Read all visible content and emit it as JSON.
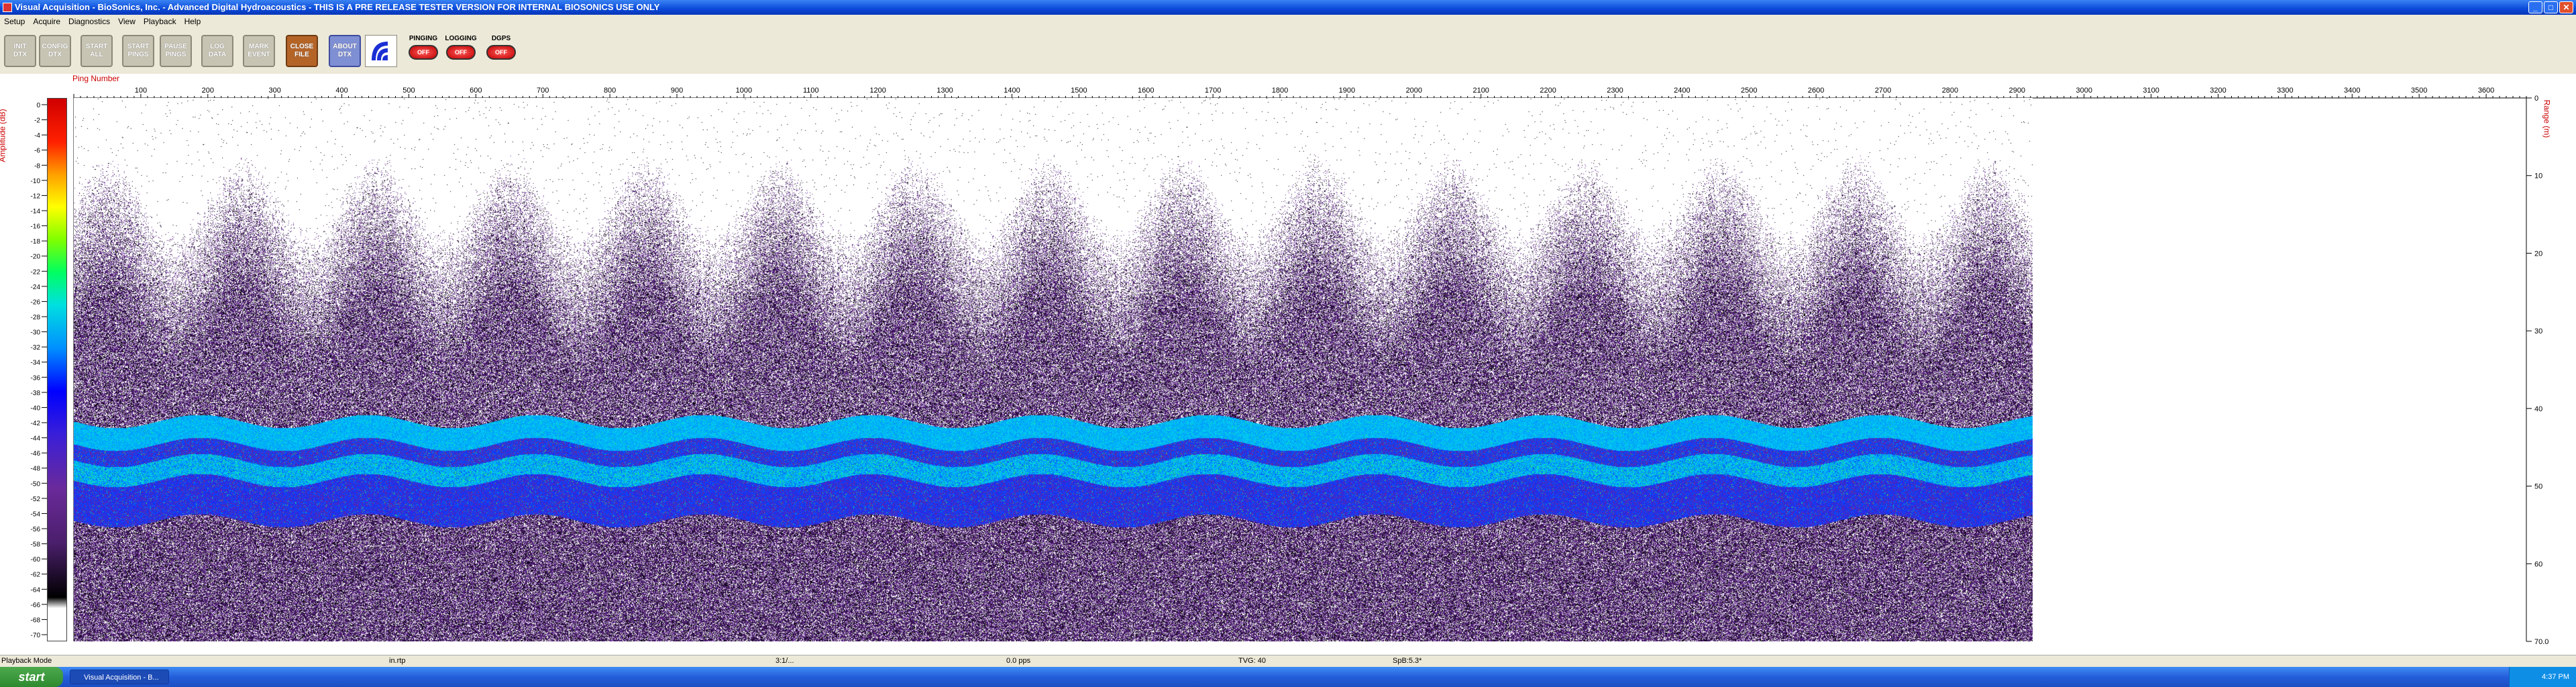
{
  "window": {
    "title": "Visual Acquisition  -  BioSonics, Inc.  -  Advanced Digital Hydroacoustics  -  THIS IS A PRE RELEASE TESTER VERSION FOR INTERNAL BIOSONICS USE ONLY"
  },
  "menu": [
    "Setup",
    "Acquire",
    "Diagnostics",
    "View",
    "Playback",
    "Help"
  ],
  "toolbar": {
    "buttons": [
      {
        "label": "INIT\nDTX",
        "color": "#c7c4b3"
      },
      {
        "label": "CONFIG\nDTX",
        "color": "#c7c4b3"
      },
      {
        "label": "START\nALL",
        "color": "#c7c4b3"
      },
      {
        "label": "START\nPINGS",
        "color": "#c7c4b3"
      },
      {
        "label": "PAUSE\nPINGS",
        "color": "#c7c4b3"
      },
      {
        "label": "LOG\nDATA",
        "color": "#c7c4b3"
      },
      {
        "label": "MARK\nEVENT",
        "color": "#c7c4b3"
      },
      {
        "label": "CLOSE\nFILE",
        "color": "#b56428"
      },
      {
        "label": "ABOUT\nDTX",
        "color": "#7f8fd3"
      }
    ],
    "indicators": [
      {
        "label": "PINGING",
        "state": "OFF"
      },
      {
        "label": "LOGGING",
        "state": "OFF"
      },
      {
        "label": "DGPS",
        "state": "OFF"
      }
    ]
  },
  "echogram": {
    "ping_axis_label": "Ping Number",
    "amp_axis_label": "Amplitude (dB)",
    "range_axis_label": "Range (m)",
    "ping_ticks": [
      100,
      200,
      300,
      400,
      500,
      600,
      700,
      800,
      900,
      1000,
      1100,
      1200,
      1300,
      1400,
      1500,
      1600,
      1700,
      1800,
      1900,
      2000,
      2100,
      2200,
      2300,
      2400,
      2500,
      2600,
      2700,
      2800,
      2900,
      3000,
      3100,
      3200,
      3300,
      3400,
      3500,
      3600
    ],
    "amp_ticks": [
      0,
      -2,
      -4,
      -6,
      -8,
      -10,
      -12,
      -14,
      -16,
      -18,
      -20,
      -22,
      -24,
      -26,
      -28,
      -30,
      -32,
      -34,
      -36,
      -38,
      -40,
      -42,
      -44,
      -46,
      -48,
      -50,
      -52,
      -54,
      -56,
      -58,
      -60,
      -62,
      -64,
      -66,
      -68,
      -70
    ],
    "range_ticks": [
      "0",
      "10",
      "20",
      "30",
      "40",
      "50",
      "60",
      "70.0"
    ],
    "data_end_ping": 2930,
    "colors": [
      "#ffffff",
      "#000000",
      "#4a1f6b",
      "#6a2a9a",
      "#3a1fd8",
      "#0000ff",
      "#0090ff",
      "#00e0e0",
      "#00ff60",
      "#80ff00",
      "#ffff00",
      "#ffa000",
      "#ff2000",
      "#d00000"
    ]
  },
  "status": {
    "mode": "Playback Mode",
    "file": "in.rtp",
    "time": "3:1/...",
    "pps": "0.0 pps",
    "tvg": "TVG: 40",
    "spb": "SpB:5.3*"
  },
  "taskbar": {
    "start_label": "start",
    "task_label": "Visual Acquisition - B...",
    "clock": "4:37 PM"
  }
}
